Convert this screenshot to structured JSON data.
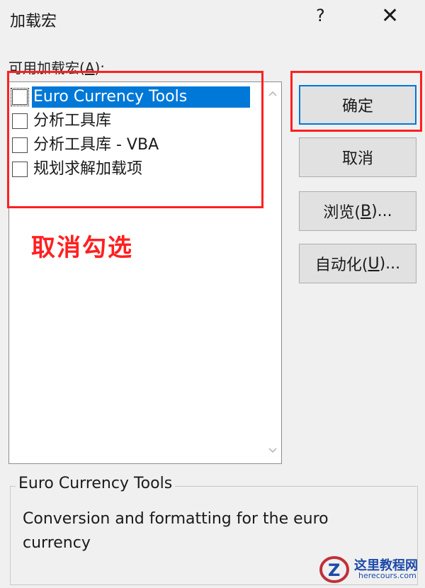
{
  "window": {
    "title": "加载宏",
    "help_glyph": "?",
    "close_glyph": "✕"
  },
  "addins": {
    "label": "可用加载宏(A):",
    "label_prefix": "可用加载宏(",
    "label_key": "A",
    "label_suffix": "):",
    "items": [
      {
        "label": "Euro Currency Tools",
        "checked": false,
        "selected": true
      },
      {
        "label": "分析工具库",
        "checked": false,
        "selected": false
      },
      {
        "label": "分析工具库 - VBA",
        "checked": false,
        "selected": false
      },
      {
        "label": "规划求解加载项",
        "checked": false,
        "selected": false
      }
    ]
  },
  "buttons": {
    "ok": "确定",
    "cancel": "取消",
    "browse": {
      "prefix": "浏览(",
      "key": "B",
      "suffix": ")..."
    },
    "automation": {
      "prefix": "自动化(",
      "key": "U",
      "suffix": ")..."
    }
  },
  "annotation": {
    "text": "取消勾选",
    "color": "#ff2020"
  },
  "description": {
    "title": "Euro Currency Tools",
    "text": "Conversion and formatting for the euro currency"
  },
  "watermark": {
    "cn": "这里教程网",
    "en": "herecours.com"
  },
  "colors": {
    "selection": "#0078d7",
    "annotation": "#ff2020",
    "watermark": "#1d4aa8"
  }
}
